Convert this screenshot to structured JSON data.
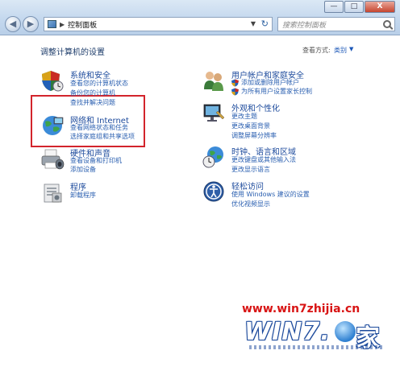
{
  "window": {
    "minimize_label": "—",
    "maximize_label": "□",
    "close_label": "X"
  },
  "nav": {
    "address_text": "控制面板",
    "search_placeholder": "搜索控制面板"
  },
  "page": {
    "heading": "调整计算机的设置",
    "view_by_label": "查看方式:",
    "view_by_value": "类别"
  },
  "categories": {
    "system_security": {
      "title": "系统和安全",
      "links": [
        "查看您的计算机状态",
        "备份您的计算机",
        "查找并解决问题"
      ]
    },
    "network": {
      "title": "网络和 Internet",
      "links": [
        "查看网络状态和任务",
        "选择家庭组和共享选项"
      ]
    },
    "hardware": {
      "title": "硬件和声音",
      "links": [
        "查看设备和打印机",
        "添加设备"
      ]
    },
    "programs": {
      "title": "程序",
      "links": [
        "卸载程序"
      ]
    },
    "user_accounts": {
      "title": "用户帐户和家庭安全",
      "links": [
        "添加或删除用户帐户",
        "为所有用户设置家长控制"
      ]
    },
    "appearance": {
      "title": "外观和个性化",
      "links": [
        "更改主题",
        "更改桌面背景",
        "调整屏幕分辨率"
      ]
    },
    "clock": {
      "title": "时钟、语言和区域",
      "links": [
        "更改键盘或其他输入法",
        "更改显示语言"
      ]
    },
    "ease": {
      "title": "轻松访问",
      "links": [
        "使用 Windows 建议的设置",
        "优化视频显示"
      ]
    }
  },
  "watermark": {
    "url": "www.win7zhijia.cn",
    "logo_text": "WIN7.",
    "logo_char": "家"
  }
}
